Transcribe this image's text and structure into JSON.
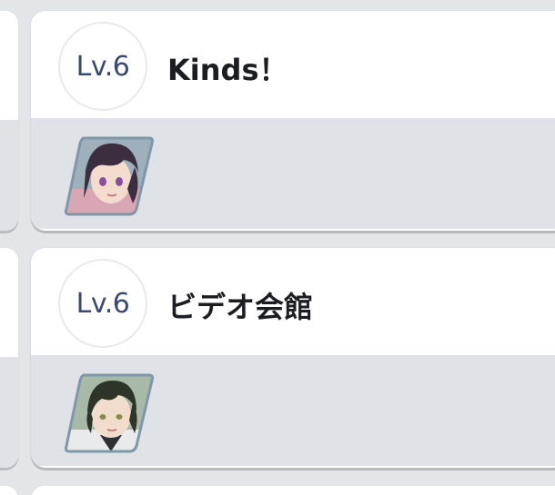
{
  "units": [
    {
      "level": "Lv.6",
      "name": "Kinds！",
      "member_avatar": "dark-purple-haired-character-icon"
    },
    {
      "level": "Lv.6",
      "name": "ビデオ会館",
      "member_avatar": "dark-green-haired-character-icon"
    }
  ],
  "colors": {
    "background": "#e3e5e8",
    "card": "#ffffff",
    "card_lower": "#dfe2e6",
    "level_text": "#3a4a6e",
    "avatar_border": "#7f98a8"
  }
}
